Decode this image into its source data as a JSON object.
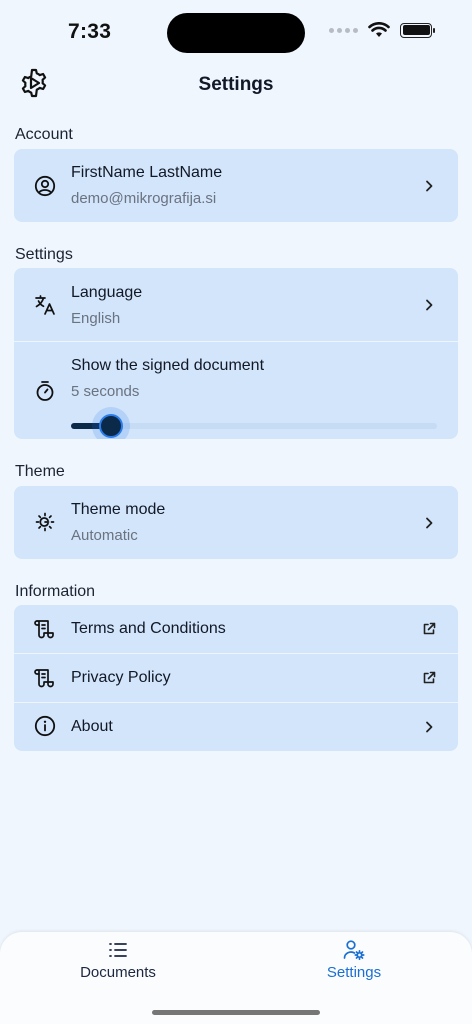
{
  "status_bar": {
    "time": "7:33"
  },
  "header": {
    "title": "Settings"
  },
  "sections": {
    "account": {
      "label": "Account",
      "user_name": "FirstName LastName",
      "user_email": "demo@mikrografija.si"
    },
    "settings": {
      "label": "Settings",
      "language_title": "Language",
      "language_value": "English",
      "signed_doc_title": "Show the signed document",
      "signed_doc_value": "5 seconds",
      "signed_doc_slider_fraction": 0.11
    },
    "theme": {
      "label": "Theme",
      "mode_title": "Theme mode",
      "mode_value": "Automatic"
    },
    "information": {
      "label": "Information",
      "terms": "Terms and Conditions",
      "privacy": "Privacy Policy",
      "about": "About"
    }
  },
  "bottom_nav": {
    "documents": "Documents",
    "settings": "Settings",
    "active": "settings"
  },
  "colors": {
    "background": "#f0f6fd",
    "card": "#d2e5fb",
    "accent": "#1a6fd1",
    "slider_fill": "#0b2a4a"
  },
  "icons": {
    "logo": "gear-play-icon",
    "account": "user-circle-icon",
    "language": "translate-icon",
    "signed_doc": "timer-icon",
    "theme": "brightness-auto-icon",
    "terms": "scroll-icon",
    "privacy": "scroll-icon",
    "about": "info-icon",
    "chevron": "chevron-right-icon",
    "external": "external-link-icon",
    "documents": "list-icon",
    "settings": "user-gear-icon"
  }
}
